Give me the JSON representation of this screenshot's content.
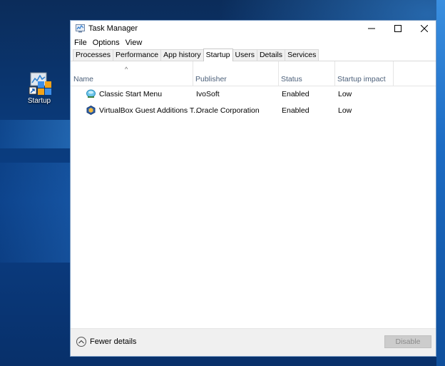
{
  "desktop": {
    "icon_label": "Startup"
  },
  "window": {
    "title": "Task Manager",
    "menu": [
      "File",
      "Options",
      "View"
    ],
    "tabs": [
      "Processes",
      "Performance",
      "App history",
      "Startup",
      "Users",
      "Details",
      "Services"
    ],
    "active_tab": "Startup",
    "columns": {
      "name": "Name",
      "publisher": "Publisher",
      "status": "Status",
      "impact": "Startup impact"
    },
    "rows": [
      {
        "name": "Classic Start Menu",
        "publisher": "IvoSoft",
        "status": "Enabled",
        "impact": "Low",
        "icon": "shell-icon"
      },
      {
        "name": "VirtualBox Guest Additions T...",
        "publisher": "Oracle Corporation",
        "status": "Enabled",
        "impact": "Low",
        "icon": "virtualbox-icon"
      }
    ],
    "footer": {
      "fewer_details": "Fewer details",
      "disable": "Disable"
    }
  }
}
